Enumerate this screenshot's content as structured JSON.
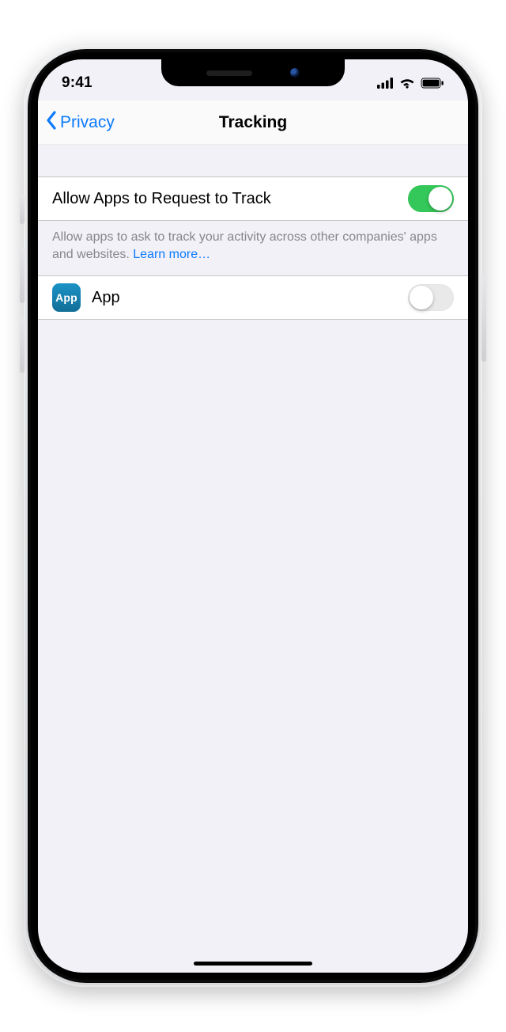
{
  "status": {
    "time": "9:41"
  },
  "nav": {
    "back_label": "Privacy",
    "title": "Tracking"
  },
  "main": {
    "allow_cell_label": "Allow Apps to Request to Track",
    "allow_cell_on": true,
    "footer_text": "Allow apps to ask to track your activity across other companies' apps and websites. ",
    "footer_link": "Learn more…"
  },
  "apps": [
    {
      "icon_label": "App",
      "name": "App",
      "tracking_on": false
    }
  ]
}
